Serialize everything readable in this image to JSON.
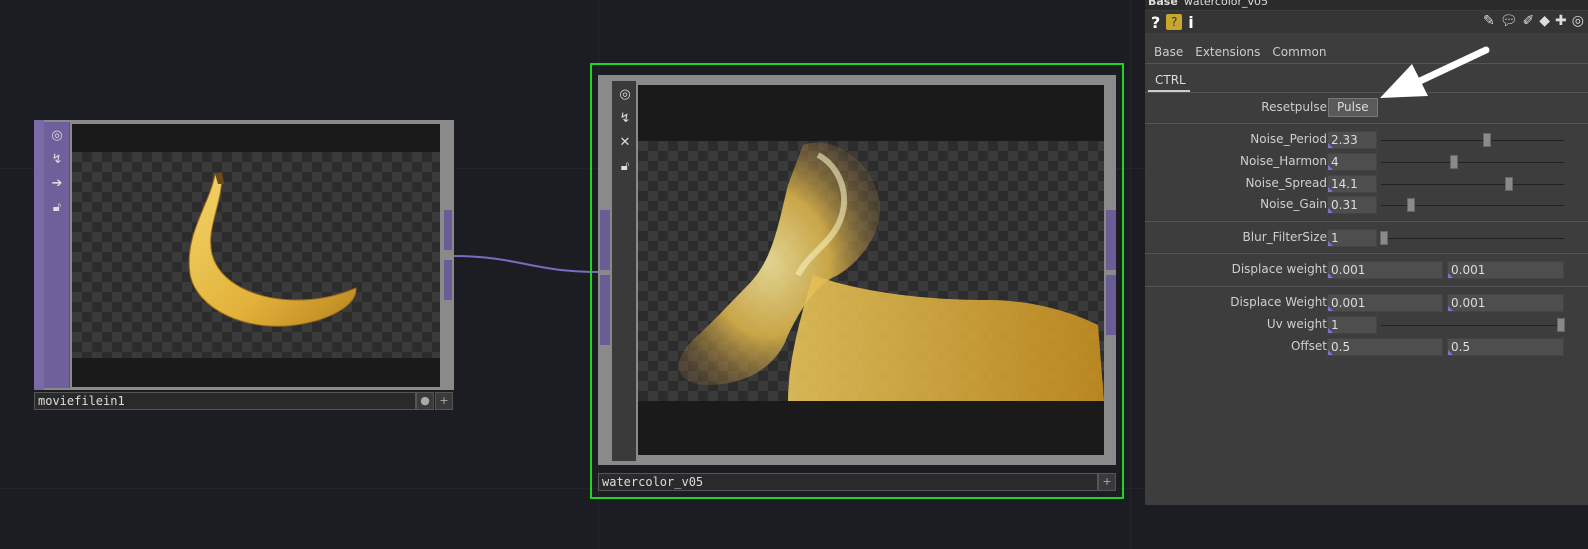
{
  "node1": {
    "label": "moviefilein1",
    "icons": [
      "viewer-icon",
      "bypass-icon",
      "display-icon",
      "lock-icon"
    ]
  },
  "node2": {
    "label": "watercolor_v05",
    "icons": [
      "viewer-icon",
      "bypass-icon",
      "close-icon",
      "lock-icon"
    ]
  },
  "panel": {
    "op_type": "Base",
    "op_name": "watercolor_v05",
    "tabs": [
      "Base",
      "Extensions",
      "Common"
    ],
    "subtab": "CTRL",
    "resetpulse": {
      "label": "Resetpulse",
      "button": "Pulse"
    },
    "noise_period": {
      "label": "Noise_Period",
      "value": "2.33"
    },
    "noise_harmon": {
      "label": "Noise_Harmon",
      "value": "4"
    },
    "noise_spread": {
      "label": "Noise_Spread",
      "value": "14.1"
    },
    "noise_gain": {
      "label": "Noise_Gain",
      "value": "0.31"
    },
    "blur_filtersize": {
      "label": "Blur_FilterSize",
      "value": "1"
    },
    "displace_weight_a": {
      "label": "Displace weight",
      "value1": "0.001",
      "value2": "0.001"
    },
    "displace_weight_b": {
      "label": "Displace Weight",
      "value1": "0.001",
      "value2": "0.001"
    },
    "uv_weight": {
      "label": "Uv weight",
      "value": "1"
    },
    "offset": {
      "label": "Offset",
      "value1": "0.5",
      "value2": "0.5"
    }
  },
  "colors": {
    "selected_outline": "#22d322",
    "wire": "#7a6ac0",
    "background": "#1c1d22"
  }
}
